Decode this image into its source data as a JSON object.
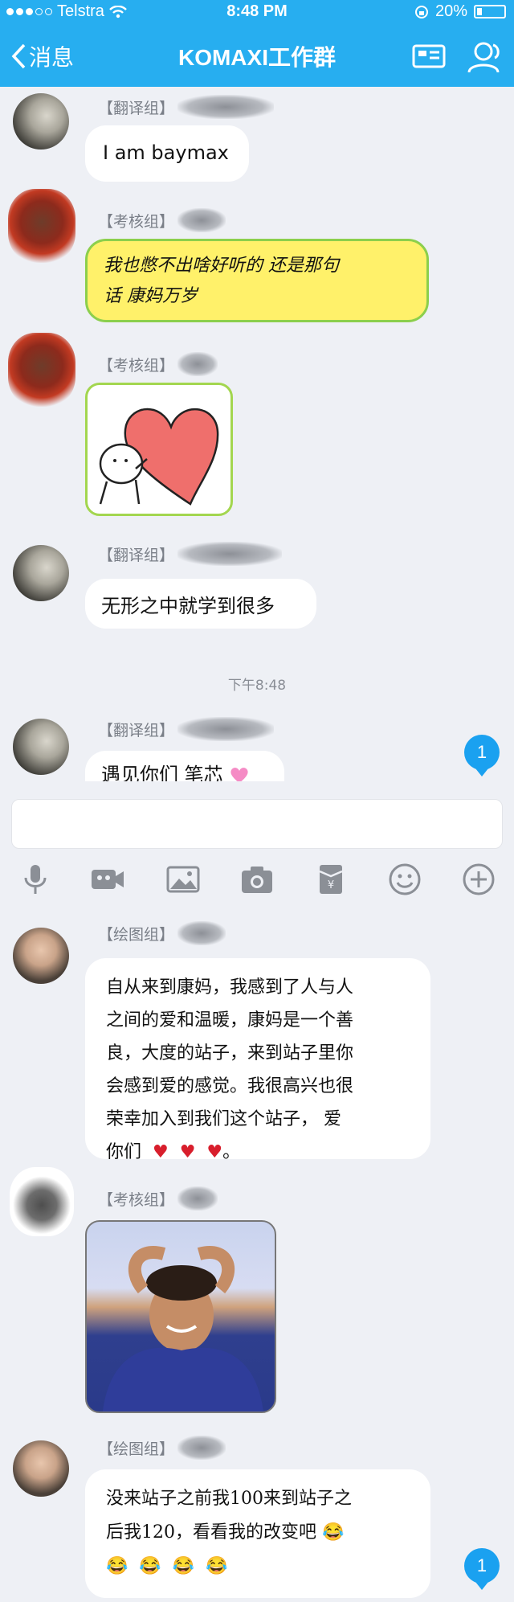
{
  "status_bar": {
    "carrier": "Telstra",
    "time": "8:48 PM",
    "battery": "20%",
    "battery_level": 0.2
  },
  "nav": {
    "back_label": "消息",
    "title": "KOMAXI工作群"
  },
  "messages": [
    {
      "sender": "【翻译组】",
      "text": "I  am baymax"
    },
    {
      "sender": "【考核组】",
      "line1": "我也憋不出啥好听的  还是那句",
      "line2": "话  康妈万岁"
    },
    {
      "sender": "【考核组】",
      "sticker": "heart-sticker"
    },
    {
      "sender": "【翻译组】",
      "text": "无形之中就学到很多"
    },
    {
      "sender": "【翻译组】",
      "text": "遇见你们 笔芯"
    },
    {
      "sender": "【绘图组】",
      "lines": [
        "自从来到康妈，我感到了人与人",
        "之间的爱和温暖，康妈是一个善",
        "良，大度的站子，来到站子里你",
        "会感到爱的感觉。我很高兴也很",
        "荣幸加入到我们这个站子，  爱",
        "你们"
      ]
    },
    {
      "sender": "【考核组】",
      "photo": "photo-of-person"
    },
    {
      "sender": "【绘图组】",
      "line1": "没来站子之前我100来到站子之",
      "line2": "后我120，看看我的改变吧"
    }
  ],
  "timestamp": "下午8:48",
  "badges": [
    "1",
    "1"
  ],
  "toolbar": [
    "microphone-icon",
    "video-icon",
    "image-icon",
    "camera-icon",
    "red-packet-icon",
    "emoji-icon",
    "plus-icon"
  ],
  "colors": {
    "brand": "#27aef0",
    "badge": "#1aa1f0"
  }
}
